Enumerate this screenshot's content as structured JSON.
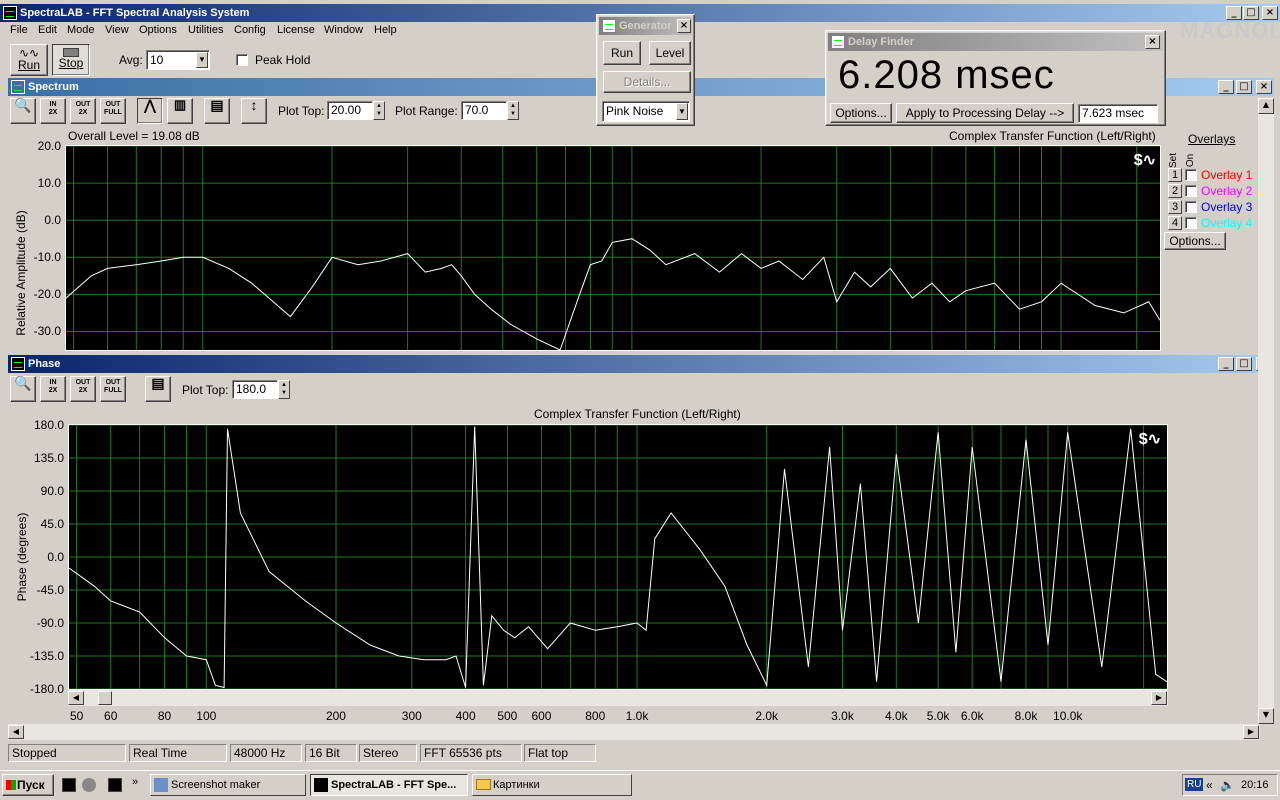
{
  "app": {
    "title": "SpectraLAB - FFT Spectral Analysis System",
    "logo_text": "MAGNOLA"
  },
  "menu": [
    "File",
    "Edit",
    "Mode",
    "View",
    "Options",
    "Utilities",
    "Config",
    "License",
    "Window",
    "Help"
  ],
  "toolbar": {
    "run_label": "Run",
    "stop_label": "Stop",
    "avg_label": "Avg:",
    "avg_value": "10",
    "peak_hold_label": "Peak Hold"
  },
  "generator": {
    "title": "Generator",
    "run_label": "Run",
    "level_label": "Level",
    "details_label": "Details...",
    "signal_value": "Pink Noise"
  },
  "delay_finder": {
    "title": "Delay Finder",
    "value": "6.208 msec",
    "options_label": "Options...",
    "apply_label": "Apply to Processing Delay -->",
    "delay_value": "7.623 msec"
  },
  "spectrum": {
    "title": "Spectrum",
    "plot_top_label": "Plot Top:",
    "plot_top_value": "20.00",
    "plot_range_label": "Plot Range:",
    "plot_range_value": "70.0",
    "overall_level": "Overall Level = 19.08 dB",
    "chart_title": "Complex Transfer Function (Left/Right)",
    "ylabel": "Relative Amplitude (dB)",
    "yticks": [
      "20.0",
      "10.0",
      "0.0",
      "-10.0",
      "-20.0",
      "-30.0"
    ],
    "overlays_label": "Overlays",
    "set_label": "Set",
    "on_label": "On",
    "overlays": [
      {
        "num": "1",
        "name": "Overlay 1",
        "color": "#ff0000"
      },
      {
        "num": "2",
        "name": "Overlay 2",
        "color": "#ff00ff"
      },
      {
        "num": "3",
        "name": "Overlay 3",
        "color": "#0000ff"
      },
      {
        "num": "4",
        "name": "Overlay 4",
        "color": "#00ffff"
      }
    ],
    "overlay_options_label": "Options..."
  },
  "phase": {
    "title": "Phase",
    "plot_top_label": "Plot Top:",
    "plot_top_value": "180.0",
    "chart_title": "Complex Transfer Function (Left/Right)",
    "ylabel": "Phase (degrees)",
    "yticks": [
      "180.0",
      "135.0",
      "90.0",
      "45.0",
      "0.0",
      "-45.0",
      "-90.0",
      "-135.0",
      "-180.0"
    ]
  },
  "xticks": [
    "50",
    "60",
    "80",
    "100",
    "200",
    "300",
    "400",
    "500",
    "600",
    "800",
    "1.0k",
    "2.0k",
    "3.0k",
    "4.0k",
    "5.0k",
    "6.0k",
    "8.0k",
    "10.0k"
  ],
  "statusbar": [
    "Stopped",
    "Real Time",
    "48000 Hz",
    "16 Bit",
    "Stereo",
    "FFT 65536 pts",
    "Flat top"
  ],
  "taskbar": {
    "start_label": "Пуск",
    "items": [
      "Screenshot maker",
      "SpectraLAB - FFT Spe...",
      "Картинки"
    ],
    "lang": "RU",
    "clock": "20:16"
  },
  "chart_data": [
    {
      "type": "line",
      "title": "Complex Transfer Function (Left/Right)",
      "ylabel": "Relative Amplitude (dB)",
      "xscale": "log",
      "xlim": [
        48,
        17000
      ],
      "ylim": [
        -35,
        20
      ],
      "x": [
        48,
        55,
        60,
        70,
        80,
        90,
        100,
        115,
        130,
        160,
        180,
        200,
        230,
        260,
        300,
        330,
        360,
        380,
        400,
        430,
        470,
        520,
        600,
        680,
        750,
        800,
        850,
        900,
        1000,
        1100,
        1200,
        1400,
        1600,
        1800,
        2000,
        2200,
        2500,
        2800,
        3000,
        3300,
        3600,
        4000,
        4500,
        5000,
        5500,
        6000,
        7000,
        8000,
        9000,
        10000,
        12000,
        14000,
        16000,
        17000
      ],
      "y": [
        -21,
        -15,
        -13,
        -12,
        -11,
        -10,
        -10,
        -13,
        -17,
        -26,
        -18,
        -10,
        -12,
        -11,
        -9,
        -14,
        -13,
        -12,
        -15,
        -20,
        -24,
        -28,
        -32,
        -36,
        -21,
        -12,
        -11,
        -6,
        -5,
        -8,
        -12,
        -9,
        -14,
        -9,
        -13,
        -11,
        -16,
        -10,
        -22,
        -14,
        -18,
        -13,
        -21,
        -17,
        -22,
        -19,
        -17,
        -24,
        -22,
        -17,
        -23,
        -25,
        -22,
        -27
      ]
    },
    {
      "type": "line",
      "title": "Complex Transfer Function (Left/Right)",
      "ylabel": "Phase (degrees)",
      "xscale": "log",
      "xlim": [
        48,
        17000
      ],
      "ylim": [
        -180,
        180
      ],
      "x": [
        48,
        55,
        60,
        70,
        80,
        90,
        100,
        105,
        110,
        112,
        120,
        140,
        170,
        200,
        240,
        280,
        320,
        360,
        380,
        400,
        420,
        440,
        460,
        490,
        520,
        560,
        620,
        700,
        800,
        900,
        1000,
        1050,
        1100,
        1200,
        1400,
        1600,
        1800,
        2000,
        2200,
        2500,
        2800,
        3000,
        3300,
        3600,
        4000,
        4500,
        5000,
        5500,
        6000,
        7000,
        8000,
        9000,
        10000,
        12000,
        14000,
        16000,
        17000
      ],
      "y": [
        -15,
        -40,
        -60,
        -75,
        -110,
        -135,
        -140,
        -175,
        -178,
        175,
        60,
        -20,
        -60,
        -90,
        -120,
        -135,
        -140,
        -140,
        -135,
        -178,
        178,
        -175,
        -80,
        -100,
        -110,
        -95,
        -125,
        -90,
        -100,
        -95,
        -90,
        -100,
        25,
        60,
        10,
        -40,
        -120,
        -175,
        120,
        -150,
        150,
        -100,
        100,
        -170,
        140,
        -90,
        170,
        -130,
        150,
        -170,
        160,
        -120,
        170,
        -150,
        175,
        -160,
        -170
      ]
    }
  ]
}
